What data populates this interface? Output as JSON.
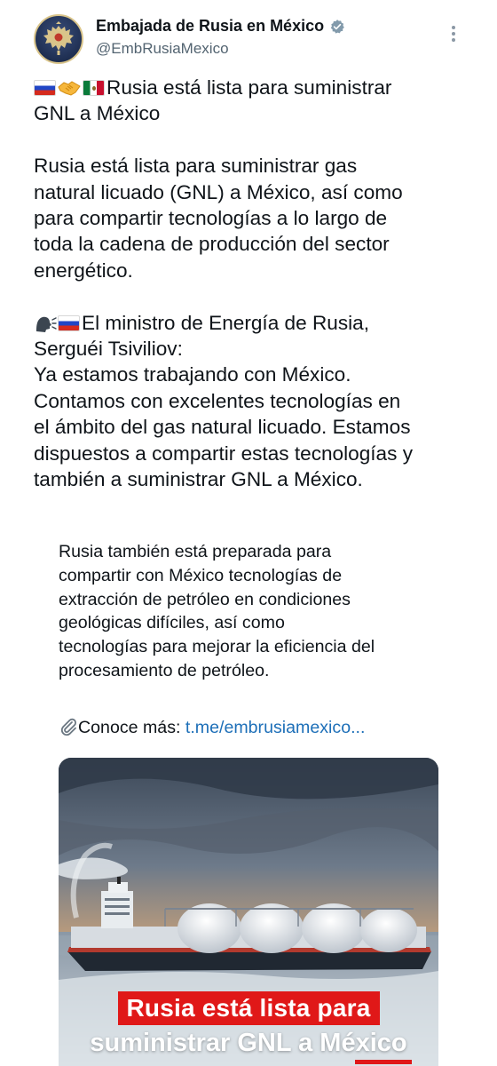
{
  "account": {
    "name": "Embajada de Rusia en México",
    "handle": "@EmbRusiaMexico",
    "verified": true,
    "avatar_icon": "double-headed-eagle-emblem"
  },
  "tweet": {
    "headline_emojis": [
      "russia-flag",
      "handshake",
      "mexico-flag"
    ],
    "headline": [
      "Rusia está lista para suministrar",
      "GNL a México"
    ],
    "paragraph1": [
      "Rusia está lista para suministrar gas",
      "natural licuado (GNL) a México, así como",
      "para compartir tecnologías a lo largo de",
      "toda la cadena de producción del sector",
      "energético."
    ],
    "quote_emojis": [
      "speaking-head",
      "russia-flag"
    ],
    "paragraph2": [
      "El ministro de Energía de Rusia,",
      "Serguéi Tsiviliov:",
      "Ya estamos trabajando con México.",
      "Contamos con excelentes tecnologías en",
      "el ámbito del gas natural licuado. Estamos",
      "dispuestos a compartir estas tecnologías y",
      "también a suministrar GNL a México."
    ]
  },
  "quote_block": {
    "lines": [
      "Rusia también está preparada para",
      "compartir con México tecnologías de",
      "extracción de petróleo en condiciones",
      "geológicas difíciles, así como",
      "tecnologías para mejorar la eficiencia del",
      "procesamiento de petróleo."
    ],
    "link_prefix": "Conoce más: ",
    "link_text": "t.me/embrusiamexico..."
  },
  "media": {
    "banner_line1": "Rusia está lista para",
    "banner_line2": "suministrar GNL a México",
    "subject": "lng-tanker-ship",
    "banner_color": "#e01818"
  },
  "colors": {
    "text": "#0f1419",
    "secondary": "#536471",
    "verified": "#829aab",
    "link": "#1d6fb8"
  }
}
